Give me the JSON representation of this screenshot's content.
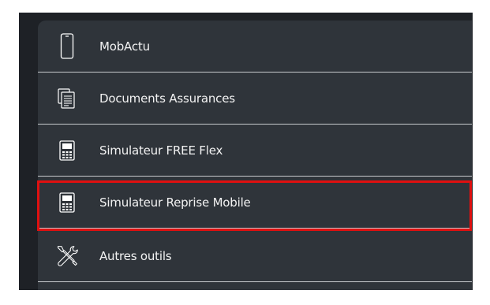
{
  "menu": {
    "items": [
      {
        "label": "MobActu",
        "icon": "smartphone-icon"
      },
      {
        "label": "Documents Assurances",
        "icon": "documents-icon"
      },
      {
        "label": "Simulateur FREE Flex",
        "icon": "calculator-icon"
      },
      {
        "label": "Simulateur Reprise Mobile",
        "icon": "calculator-icon",
        "highlighted": true
      },
      {
        "label": "Autres outils",
        "icon": "tools-icon"
      }
    ]
  },
  "colors": {
    "background": "#2f343a",
    "frame": "#1e2126",
    "divider": "#c9cbce",
    "text": "#f2f2f2",
    "highlight_border": "#e01010"
  }
}
